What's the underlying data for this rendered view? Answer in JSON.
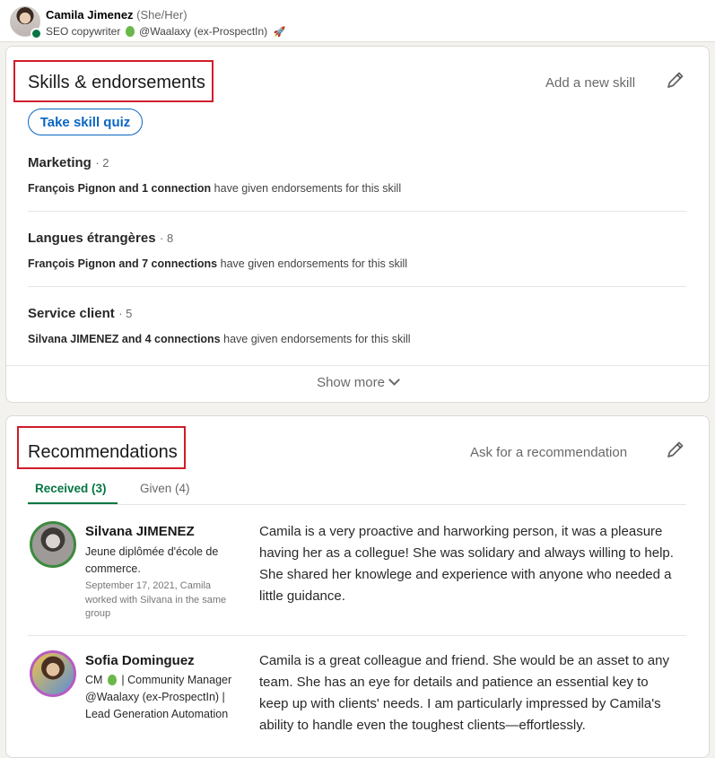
{
  "profile": {
    "name": "Camila Jimenez",
    "pronouns": "(She/Her)",
    "headline_prefix": "SEO copywriter",
    "headline_company": "@Waalaxy (ex-ProspectIn)"
  },
  "skills": {
    "title": "Skills & endorsements",
    "add_label": "Add a new skill",
    "quiz_label": "Take skill quiz",
    "items": [
      {
        "name": "Marketing",
        "count": "· 2",
        "endorsers": "François Pignon and 1 connection",
        "suffix": " have given endorsements for this skill"
      },
      {
        "name": "Langues étrangères",
        "count": "· 8",
        "endorsers": "François Pignon and 7 connections",
        "suffix": " have given endorsements for this skill"
      },
      {
        "name": "Service client",
        "count": "· 5",
        "endorsers": "Silvana JIMENEZ and 4 connections",
        "suffix": " have given endorsements for this skill"
      }
    ],
    "show_more": "Show more"
  },
  "recommendations": {
    "title": "Recommendations",
    "ask_label": "Ask for a recommendation",
    "tabs": [
      {
        "label": "Received (3)"
      },
      {
        "label": "Given (4)"
      }
    ],
    "items": [
      {
        "name": "Silvana JIMENEZ",
        "role": "Jeune diplômée d'école de commerce.",
        "meta": "September 17, 2021, Camila worked with Silvana in the same group",
        "text": "Camila is a very proactive and harworking person, it was a pleasure having her as a collegue! She was solidary and always willing to help. She shared her knowlege and experience with anyone who needed a little guidance."
      },
      {
        "name": "Sofia Dominguez",
        "role_prefix": "CM",
        "role": "| Community Manager @Waalaxy (ex-ProspectIn) | Lead Generation Automation",
        "text": "Camila is a great colleague and friend. She would be an asset to any team. She has an eye for details and patience an essential key to keep up with clients' needs. I am particularly impressed by Camila's ability to handle even the toughest clients—effortlessly."
      }
    ]
  },
  "colors": {
    "accent_blue": "#0a66c2",
    "accent_green": "#057642",
    "highlight_red": "#d01c2a"
  }
}
